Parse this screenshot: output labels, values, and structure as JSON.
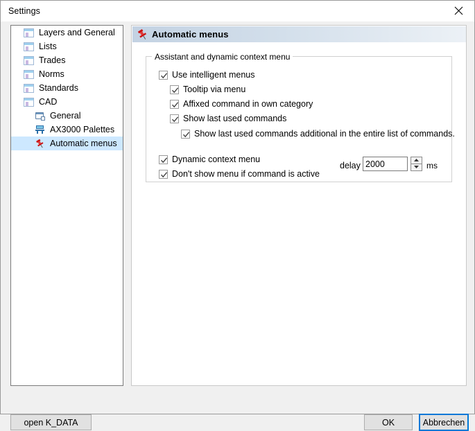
{
  "window": {
    "title": "Settings",
    "close_icon": "close-icon"
  },
  "sidebar": {
    "items": [
      {
        "label": "Layers and General",
        "icon": "list-window-icon",
        "level": 0,
        "selected": false
      },
      {
        "label": "Lists",
        "icon": "list-window-icon",
        "level": 0,
        "selected": false
      },
      {
        "label": "Trades",
        "icon": "list-window-icon",
        "level": 0,
        "selected": false
      },
      {
        "label": "Norms",
        "icon": "list-window-icon",
        "level": 0,
        "selected": false
      },
      {
        "label": "Standards",
        "icon": "list-window-icon",
        "level": 0,
        "selected": false
      },
      {
        "label": "CAD",
        "icon": "list-window-icon",
        "level": 0,
        "selected": false
      },
      {
        "label": "General",
        "icon": "window-arrow-icon",
        "level": 1,
        "selected": false
      },
      {
        "label": "AX3000 Palettes",
        "icon": "palettes-icon",
        "level": 1,
        "selected": false
      },
      {
        "label": "Automatic menus",
        "icon": "pushpin-icon",
        "level": 1,
        "selected": true
      }
    ]
  },
  "main": {
    "header": {
      "title": "Automatic menus",
      "icon": "pushpin-icon"
    },
    "group": {
      "title": "Assistant and dynamic context menu",
      "checkboxes": [
        {
          "label": "Use intelligent menus",
          "checked": true
        },
        {
          "label": "Tooltip via menu",
          "checked": true
        },
        {
          "label": "Affixed command in own category",
          "checked": true
        },
        {
          "label": "Show last used commands",
          "checked": true
        },
        {
          "label": "Show last used commands additional in the entire list of commands.",
          "checked": true
        },
        {
          "label": "Dynamic context menu",
          "checked": true
        },
        {
          "label": "Don't show menu if command is active",
          "checked": true
        }
      ],
      "delay": {
        "label": "delay",
        "value": "2000",
        "unit": "ms",
        "spin_up_icon": "chevron-up-icon",
        "spin_down_icon": "chevron-down-icon"
      }
    }
  },
  "footer": {
    "open_kdata_label": "open K_DATA",
    "ok_label": "OK",
    "cancel_label": "Abbrechen"
  },
  "colors": {
    "accent": "#0078d7",
    "selection": "#cde8ff",
    "panel_header_start": "#c3d2e3",
    "panel_header_end": "#ecf1f6",
    "pin_red": "#cc1111"
  }
}
